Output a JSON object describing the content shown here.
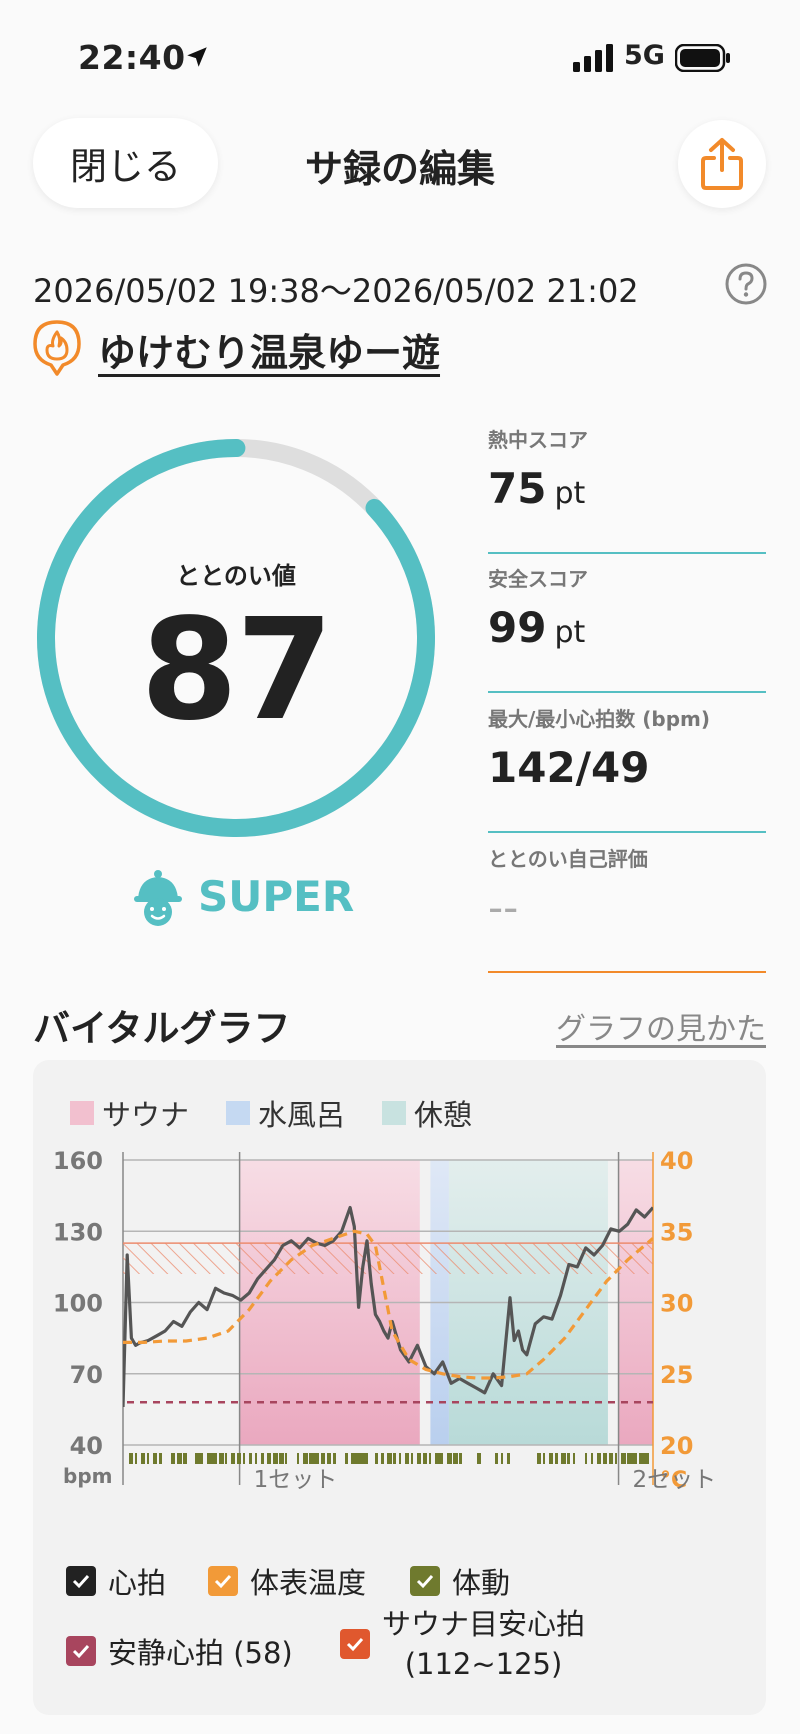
{
  "status_bar": {
    "time": "22:40",
    "network": "5G"
  },
  "header": {
    "close_label": "閉じる",
    "title": "サ録の編集"
  },
  "session": {
    "date_range": "2026/05/02 19:38〜2026/05/02 21:02",
    "place_name": "ゆけむり温泉ゆー遊"
  },
  "totonoi": {
    "label": "ととのい値",
    "value": "87",
    "gauge_fraction": 0.87,
    "level": "SUPER"
  },
  "metrics": [
    {
      "label": "熱中スコア",
      "value": "75",
      "unit": "pt"
    },
    {
      "label": "安全スコア",
      "value": "99",
      "unit": "pt"
    },
    {
      "label": "最大/最小心拍数 (bpm)",
      "value": "142/49",
      "unit": ""
    },
    {
      "label": "ととのい自己評価",
      "value": "--",
      "unit": ""
    }
  ],
  "vital_graph": {
    "title": "バイタルグラフ",
    "help_link": "グラフの見かた",
    "zones": [
      {
        "label": "サウナ",
        "color": "#f2c0cf"
      },
      {
        "label": "水風呂",
        "color": "#c5d9f2"
      },
      {
        "label": "休憩",
        "color": "#c8e2e0"
      }
    ],
    "toggles": {
      "heart": "心拍",
      "skin_temp": "体表温度",
      "movement": "体動",
      "resting_hr": "安静心拍 (58)",
      "sauna_hr_line1": "サウナ目安心拍",
      "sauna_hr_line2": "(112~125)"
    }
  },
  "chart_data": {
    "type": "line",
    "y_left_ticks": [
      "160",
      "130",
      "100",
      "70",
      "40"
    ],
    "y_left_unit": "bpm",
    "y_left_range": [
      40,
      160
    ],
    "y_right_ticks": [
      "40",
      "35",
      "30",
      "25",
      "20"
    ],
    "y_right_unit": "°C",
    "y_right_range": [
      20,
      40
    ],
    "x_labels": [
      "1セット",
      "2セット"
    ],
    "resting_hr": 58,
    "sauna_hr_band": [
      112,
      125
    ],
    "zones": [
      {
        "type": "sauna",
        "from": 0.22,
        "to": 0.56
      },
      {
        "type": "cold",
        "from": 0.58,
        "to": 0.615
      },
      {
        "type": "rest",
        "from": 0.615,
        "to": 0.915
      },
      {
        "type": "sauna",
        "from": 0.935,
        "to": 1.0
      }
    ],
    "series": [
      {
        "name": "心拍",
        "color": "#555555",
        "x": [
          0.0,
          0.01,
          0.02,
          0.03,
          0.04,
          0.06,
          0.08,
          0.1,
          0.12,
          0.14,
          0.16,
          0.18,
          0.2,
          0.22,
          0.24,
          0.26,
          0.28,
          0.3,
          0.32,
          0.34,
          0.36,
          0.38,
          0.4,
          0.42,
          0.44,
          0.46,
          0.48,
          0.5,
          0.52,
          0.54,
          0.55,
          0.56,
          0.57,
          0.58,
          0.59,
          0.6,
          0.61,
          0.62,
          0.63,
          0.64,
          0.66,
          0.68,
          0.7,
          0.72,
          0.74,
          0.76,
          0.78,
          0.8,
          0.82,
          0.84,
          0.86,
          0.88,
          0.9,
          0.92,
          0.93,
          0.94,
          0.95,
          0.96,
          0.98,
          1.0,
          1.02,
          1.04,
          1.06,
          1.08,
          1.1,
          1.12,
          1.14,
          1.16,
          1.18,
          1.2,
          1.22,
          1.24,
          1.26
        ],
        "values": [
          56,
          120,
          85,
          82,
          83,
          84,
          86,
          88,
          92,
          90,
          96,
          100,
          97,
          106,
          104,
          103,
          101,
          104,
          110,
          114,
          118,
          124,
          126,
          123,
          127,
          125,
          124,
          126,
          130,
          140,
          132,
          98,
          115,
          126,
          108,
          95,
          92,
          88,
          85,
          92,
          80,
          75,
          82,
          73,
          70,
          75,
          66,
          68,
          66,
          64,
          62,
          70,
          65,
          102,
          84,
          88,
          80,
          78,
          91,
          94,
          93,
          103,
          116,
          115,
          123,
          120,
          124,
          131,
          130,
          133,
          139,
          136,
          140
        ]
      },
      {
        "name": "体表温度",
        "color": "#f29a38",
        "x": [
          0.0,
          0.05,
          0.1,
          0.15,
          0.2,
          0.25,
          0.3,
          0.35,
          0.4,
          0.45,
          0.5,
          0.55,
          0.58,
          0.6,
          0.62,
          0.64,
          0.68,
          0.72,
          0.76,
          0.8,
          0.84,
          0.88,
          0.92,
          0.96,
          1.0,
          1.05,
          1.1,
          1.15,
          1.2,
          1.26
        ],
        "values": [
          27.2,
          27.2,
          27.3,
          27.3,
          27.5,
          28.0,
          29.5,
          31.5,
          33.0,
          34.0,
          34.5,
          35.0,
          34.8,
          34.0,
          31.0,
          28.0,
          26.0,
          25.3,
          25.0,
          24.8,
          24.7,
          24.7,
          24.8,
          25.0,
          26.0,
          27.5,
          29.5,
          31.5,
          33.0,
          34.5
        ]
      }
    ]
  }
}
